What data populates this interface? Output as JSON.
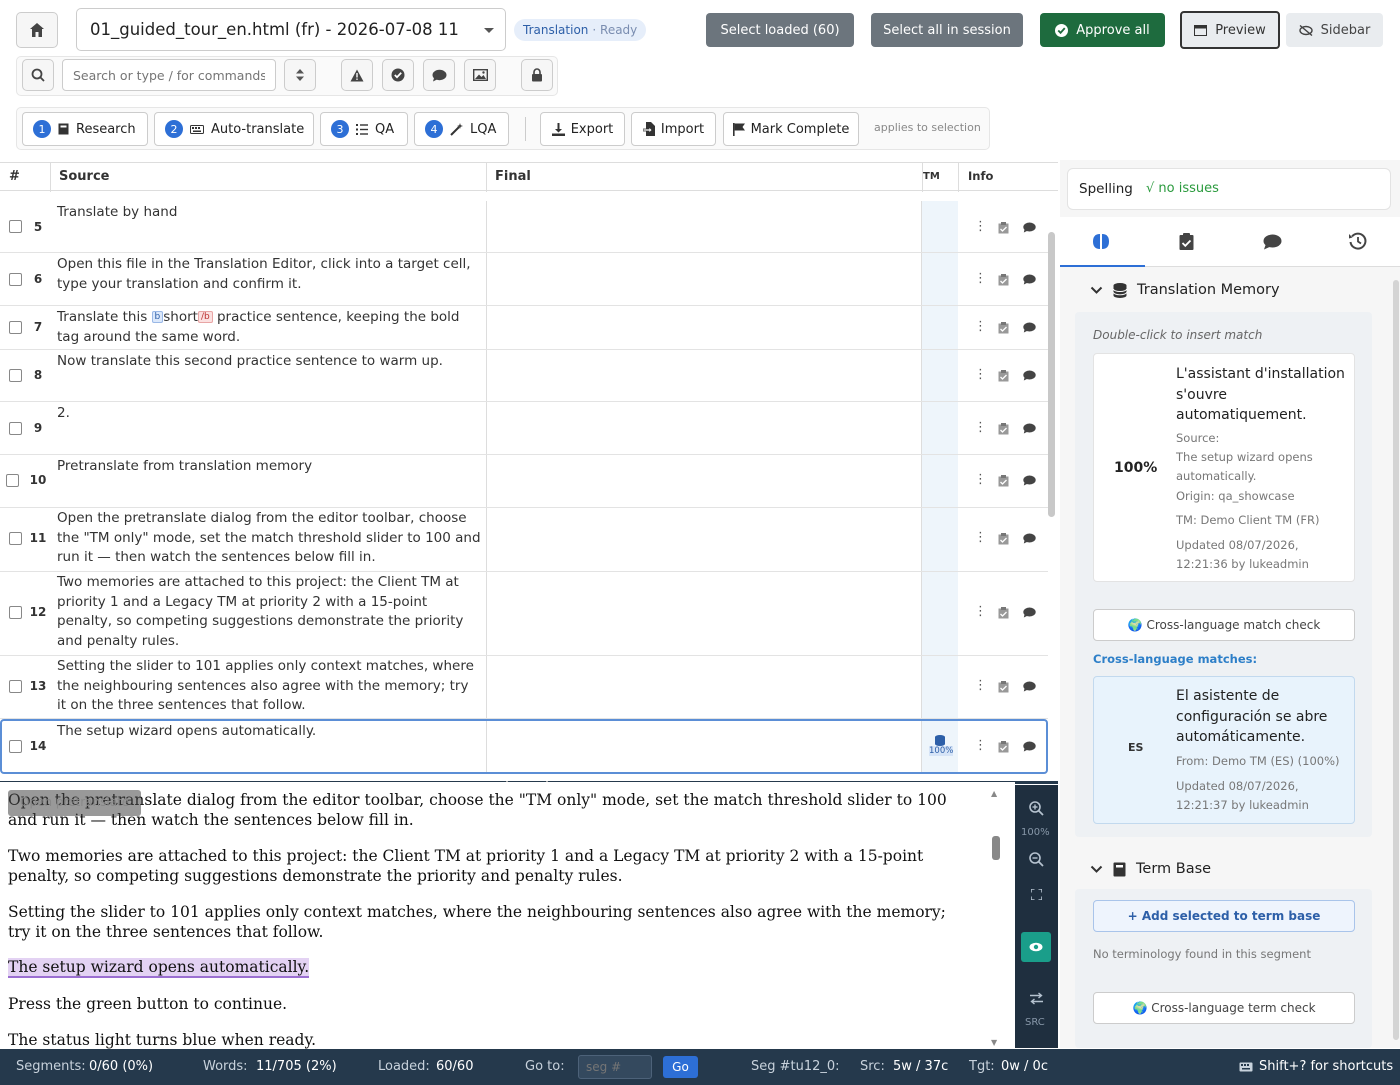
{
  "header": {
    "file_title": "01_guided_tour_en.html (fr) - 2026-07-08 11",
    "badge_label": "Translation",
    "badge_status": "· Ready",
    "select_loaded": "Select loaded (60)",
    "select_all": "Select all in session",
    "approve_all": "Approve all",
    "preview": "Preview",
    "sidebar": "Sidebar"
  },
  "search": {
    "placeholder": "Search or type / for commands"
  },
  "steps": [
    {
      "num": "1",
      "label": "Research"
    },
    {
      "num": "2",
      "label": "Auto-translate"
    },
    {
      "num": "3",
      "label": "QA"
    },
    {
      "num": "4",
      "label": "LQA"
    }
  ],
  "actions": {
    "export": "Export",
    "import": "Import",
    "mark_complete": "Mark Complete",
    "note": "applies to selection"
  },
  "grid": {
    "col_num": "#",
    "col_source": "Source",
    "col_final": "Final",
    "col_tm": "TM",
    "col_info": "Info",
    "rows": [
      {
        "num": "5",
        "source": "Translate by hand"
      },
      {
        "num": "6",
        "source": "Open this file in the Translation Editor, click into a target cell, type your translation and confirm it."
      },
      {
        "num": "7",
        "source_pre": "Translate this ",
        "tag_open": "b",
        "source_mid": "short",
        "tag_close": "/b",
        "source_post": " practice sentence, keeping the bold tag around the same word."
      },
      {
        "num": "8",
        "source": "Now translate this second practice sentence to warm up."
      },
      {
        "num": "9",
        "source": "2."
      },
      {
        "num": "10",
        "source": "Pretranslate from translation memory"
      },
      {
        "num": "11",
        "source": "Open the pretranslate dialog from the editor toolbar, choose the \"TM only\" mode, set the match threshold slider to 100 and run it — then watch the sentences below fill in."
      },
      {
        "num": "12",
        "source": "Two memories are attached to this project: the Client TM at priority 1 and a Legacy TM at priority 2 with a 15-point penalty, so competing suggestions demonstrate the priority and penalty rules."
      },
      {
        "num": "13",
        "source": "Setting the slider to 101 applies only context matches, where the neighbouring sentences also agree with the memory; try it on the three sentences that follow."
      },
      {
        "num": "14",
        "source": "The setup wizard opens automatically.",
        "tm": "100%"
      }
    ]
  },
  "preview_pane": {
    "overlay_label": "Open pretranslate",
    "paragraphs": [
      "Open the pretranslate dialog from the editor toolbar, choose the \"TM only\" mode, set the match threshold slider to 100 and run it — then watch the sentences below fill in.",
      "Two memories are attached to this project: the Client TM at priority 1 and a Legacy TM at priority 2 with a 15-point penalty, so competing suggestions demonstrate the priority and penalty rules.",
      "Setting the slider to 101 applies only context matches, where the neighbouring sentences also agree with the memory; try it on the three sentences that follow.",
      "The setup wizard opens automatically.",
      "Press the green button to continue.",
      "The status light turns blue when ready."
    ],
    "zoom": "100%",
    "src_label": "SRC"
  },
  "sidebar": {
    "spelling_label": "Spelling",
    "spelling_status": "√ no issues",
    "tm_title": "Translation Memory",
    "tm_hint": "Double-click to insert match",
    "match": {
      "score": "100%",
      "target": "L'assistant d'installation s'ouvre automatiquement.",
      "source_label": "Source:",
      "source": "The setup wizard opens automatically.",
      "origin": "Origin: qa_showcase",
      "tm": "TM: Demo Client TM (FR)",
      "updated": "Updated 08/07/2026, 12:21:36 by lukeadmin"
    },
    "cross_check": "🌍 Cross-language match check",
    "cross_title": "Cross-language matches:",
    "cross": {
      "lang": "ES",
      "target": "El asistente de configuración se abre automáticamente.",
      "from": "From: Demo TM (ES) (100%)",
      "updated": "Updated 08/07/2026, 12:21:37 by lukeadmin"
    },
    "tb_title": "Term Base",
    "tb_add": "+ Add selected to term base",
    "tb_empty": "No terminology found in this segment",
    "tb_cross": "🌍 Cross-language term check"
  },
  "status": {
    "segments_label": "Segments:",
    "segments": "0/60 (0%)",
    "words_label": "Words:",
    "words": "11/705 (2%)",
    "loaded_label": "Loaded:",
    "loaded": "60/60",
    "goto_label": "Go to:",
    "goto_placeholder": "seg #",
    "go": "Go",
    "seg": "Seg #tu12_0:",
    "src_label": "Src:",
    "src": "5w / 37c",
    "tgt_label": "Tgt:",
    "tgt": "0w / 0c",
    "shortcuts": "Shift+? for shortcuts"
  },
  "colors": {
    "approve": "#1e6b3e",
    "gray_btn": "#6c757d",
    "step_badge": "#2d6fd6",
    "status_bg": "#25394c",
    "accent": "#2d6fd6"
  }
}
